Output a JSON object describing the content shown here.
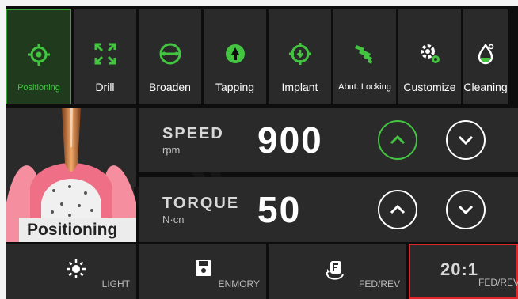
{
  "tools": [
    {
      "label": "Positioning",
      "icon": "target-icon",
      "active": true
    },
    {
      "label": "Drill",
      "icon": "expand-arrows-icon",
      "active": false
    },
    {
      "label": "Broaden",
      "icon": "broaden-circle-icon",
      "active": false
    },
    {
      "label": "Tapping",
      "icon": "tapping-icon",
      "active": false
    },
    {
      "label": "Implant",
      "icon": "implant-icon",
      "active": false
    },
    {
      "label": "Abut. Locking",
      "icon": "screw-icon",
      "active": false
    },
    {
      "label": "Customize",
      "icon": "gears-icon",
      "active": false
    },
    {
      "label": "Cleaning",
      "icon": "water-drop-icon",
      "active": false
    }
  ],
  "preview": {
    "label": "Positioning"
  },
  "speed": {
    "label": "SPEED",
    "unit": "rpm",
    "value": "900"
  },
  "torque": {
    "label": "TORQUE",
    "unit": "N·cn",
    "value": "50"
  },
  "bottom": {
    "light_label": "LIGHT",
    "memory_label": "ENMORY",
    "fedrev_label": "FED/REV",
    "ratio_value": "20:1",
    "ratio_label": "FED/REV"
  },
  "colors": {
    "accent_green": "#43c542",
    "panel": "#2a2a2a",
    "highlight_red": "#e0262a"
  }
}
